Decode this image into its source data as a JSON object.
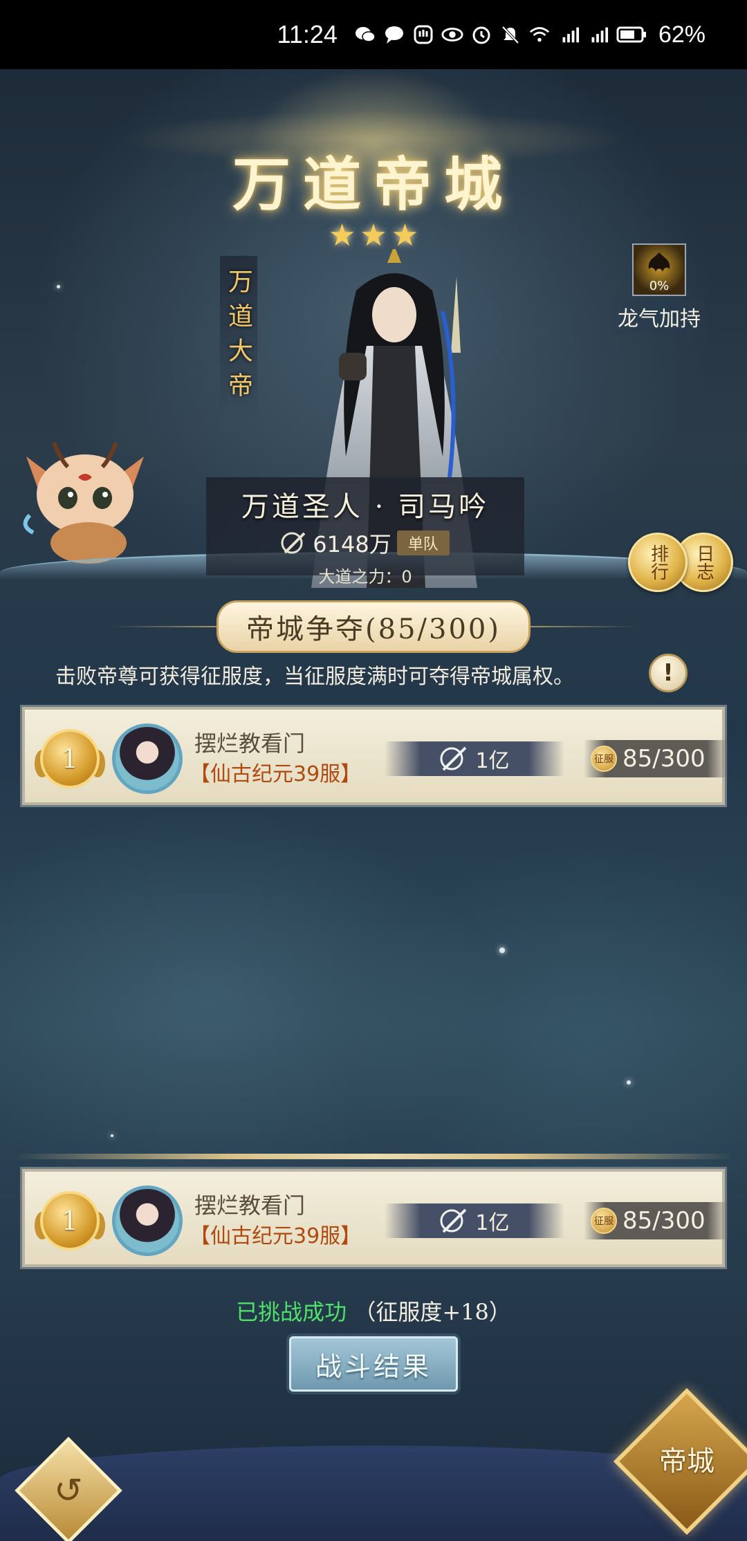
{
  "status_bar": {
    "time": "11:24",
    "battery": "62%",
    "icons": [
      "wechat-icon",
      "message-icon",
      "app-icon",
      "eye-icon",
      "alarm-icon",
      "mute-icon",
      "wifi-icon",
      "signal-3g-icon",
      "signal-4g-icon",
      "battery-icon"
    ]
  },
  "header": {
    "title": "万道帝城",
    "star_count": 3,
    "vertical_title": "万道大帝"
  },
  "dragon_qi": {
    "percent": "0%",
    "label": "龙气加持"
  },
  "hero": {
    "name": "万道圣人 · 司马吟",
    "power": "6148万",
    "team_badge": "单队",
    "dao_power": "大道之力：0"
  },
  "side_buttons": {
    "ranking": "排行",
    "log": "日志"
  },
  "contest": {
    "banner": "帝城争夺(85/300)",
    "info": "击败帝尊可获得征服度，当征服度满时可夺得帝城属权。",
    "info_button": "!"
  },
  "rank_entries": [
    {
      "rank": "1",
      "name": "摆烂教看门",
      "server": "【仙古纪元39服】",
      "power": "1亿",
      "coin_label": "征服",
      "conquest": "85/300"
    },
    {
      "rank": "1",
      "name": "摆烂教看门",
      "server": "【仙古纪元39服】",
      "power": "1亿",
      "coin_label": "征服",
      "conquest": "85/300"
    }
  ],
  "result": {
    "success_text": "已挑战成功",
    "extra_text": "（征服度+18）",
    "battle_button": "战斗结果"
  },
  "bottom": {
    "left_button": "↺",
    "city_button": "帝城"
  },
  "colors": {
    "success_green": "#4fe06a",
    "server_orange": "#b04a10",
    "gold": "#f2c76a"
  }
}
